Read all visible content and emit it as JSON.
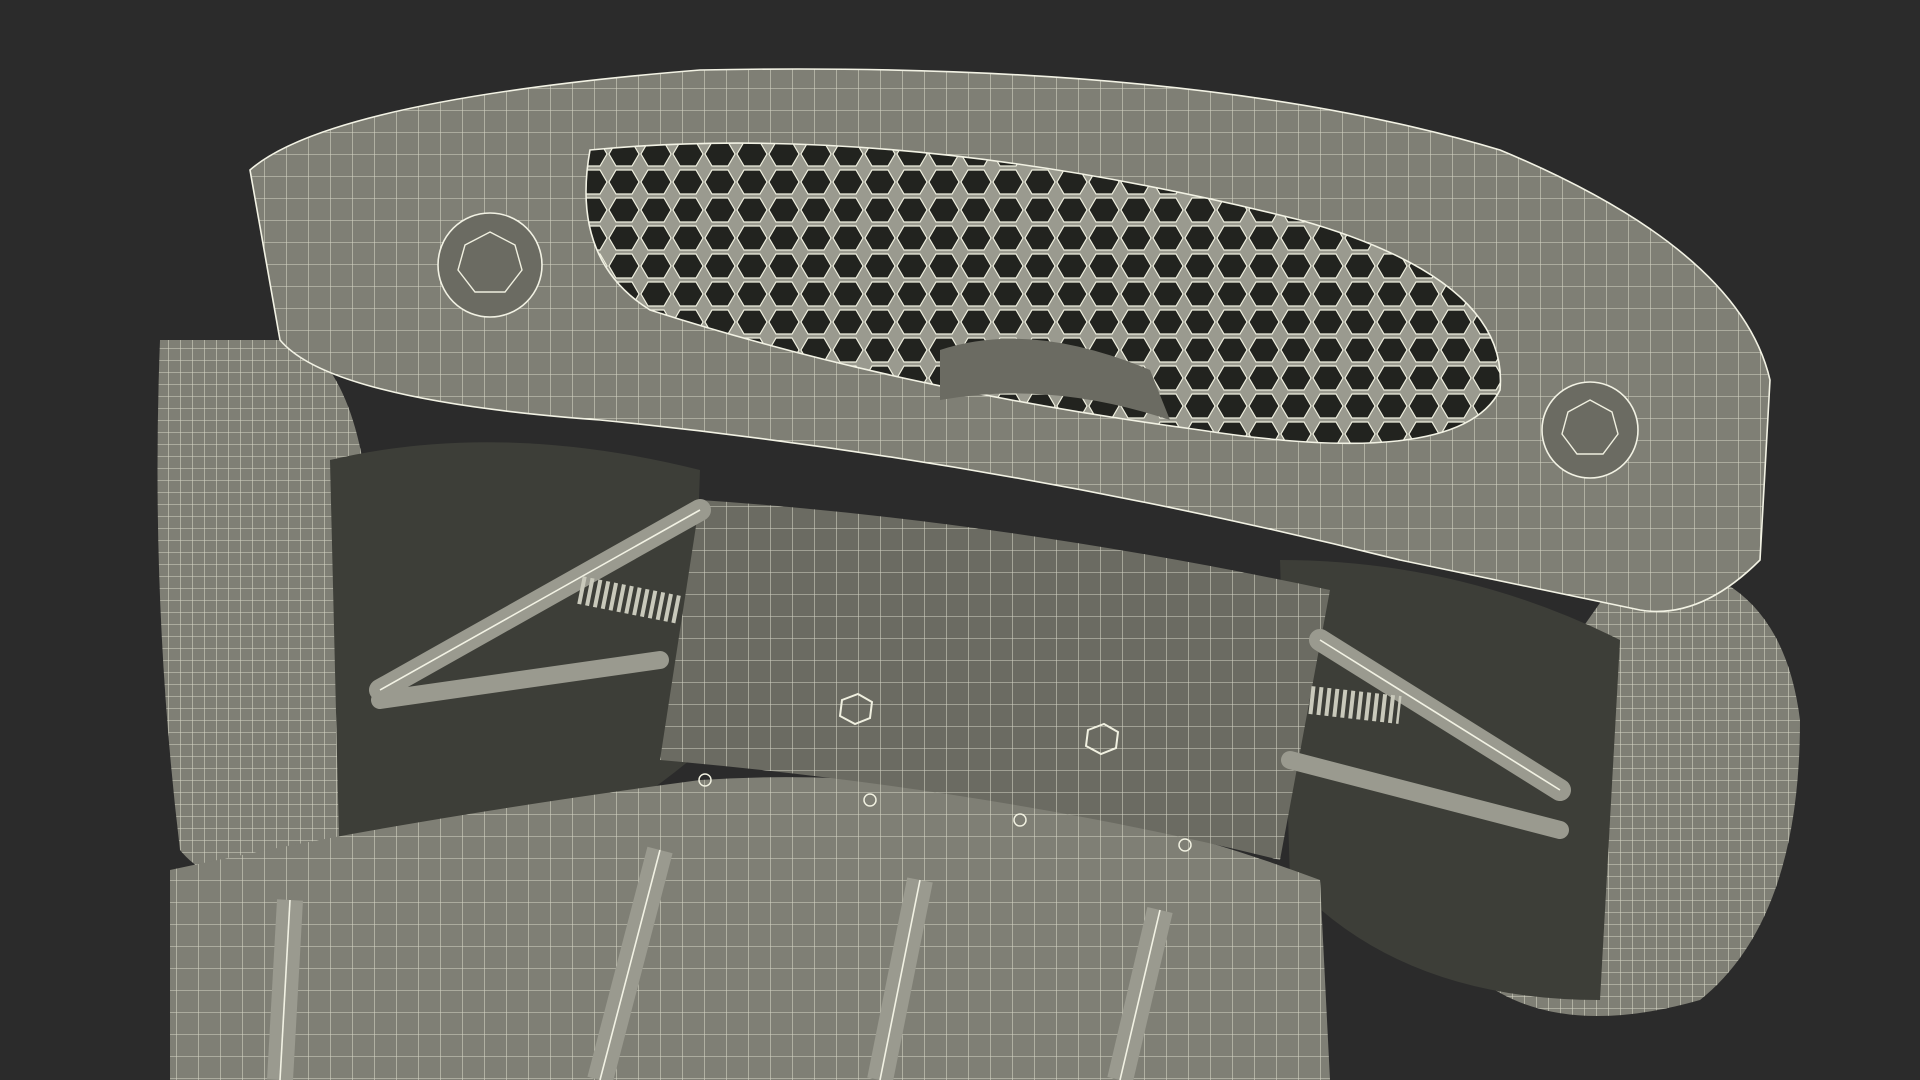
{
  "scene": {
    "subject": "car-underside-wireframe",
    "colors": {
      "background": "#2b2b2b",
      "body": "#7f7f75",
      "shadow": "#3d3e38",
      "wireframe": "#e6e6d6"
    }
  }
}
